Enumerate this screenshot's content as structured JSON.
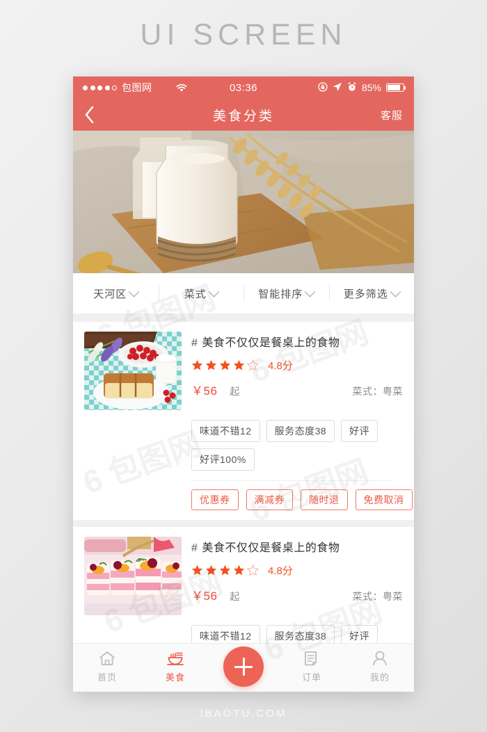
{
  "page": {
    "title": "UI SCREEN",
    "footer": "IBAOTU.COM"
  },
  "colors": {
    "header": "#e4675f",
    "accent": "#ef5a47",
    "star": "#f4511e",
    "price": "#ef4a3a",
    "tab_inactive": "#b0b0b0"
  },
  "status_bar": {
    "carrier": "包图网",
    "time": "03:36",
    "battery_percent": "85%",
    "icons": [
      "signal-dots-icon",
      "wifi-icon",
      "rotation-lock-icon",
      "location-arrow-icon",
      "alarm-clock-icon",
      "battery-icon"
    ]
  },
  "nav_bar": {
    "back_icon": "chevron-left-icon",
    "title": "美食分类",
    "action": "客服"
  },
  "hero": {
    "alt": "milk-bottle-wheat-photo"
  },
  "filters": [
    {
      "label": "天河区",
      "icon": "chevron-down-icon"
    },
    {
      "label": "菜式",
      "icon": "chevron-down-icon"
    },
    {
      "label": "智能排序",
      "icon": "chevron-down-icon"
    },
    {
      "label": "更多筛选",
      "icon": "chevron-down-icon"
    }
  ],
  "cards": [
    {
      "thumb": "berry-cake-photo",
      "hash": "#",
      "title": "美食不仅仅是餐桌上的食物",
      "stars_filled": 4,
      "stars_total": 5,
      "score": "4.8分",
      "price": "￥56",
      "price_unit": "起",
      "cuisine": "菜式：粤菜",
      "tags": [
        "味道不错12",
        "服务态度38",
        "好评",
        "好评100%"
      ],
      "coupons": [
        "优惠券",
        "满减券",
        "随时退",
        "免费取消"
      ]
    },
    {
      "thumb": "dessert-cups-photo",
      "hash": "#",
      "title": "美食不仅仅是餐桌上的食物",
      "stars_filled": 4,
      "stars_total": 5,
      "score": "4.8分",
      "price": "￥56",
      "price_unit": "起",
      "cuisine": "菜式：粤菜",
      "tags": [
        "味道不错12",
        "服务态度38",
        "好评"
      ],
      "coupons": []
    }
  ],
  "tab_bar": [
    {
      "label": "首页",
      "icon": "home-icon",
      "active": false
    },
    {
      "label": "美食",
      "icon": "bowl-icon",
      "active": true
    },
    {
      "label": "订单",
      "icon": "receipt-icon",
      "active": false
    },
    {
      "label": "我的",
      "icon": "person-icon",
      "active": false
    }
  ],
  "fab": {
    "icon": "plus-icon",
    "label": "add"
  },
  "watermark": "包图网"
}
